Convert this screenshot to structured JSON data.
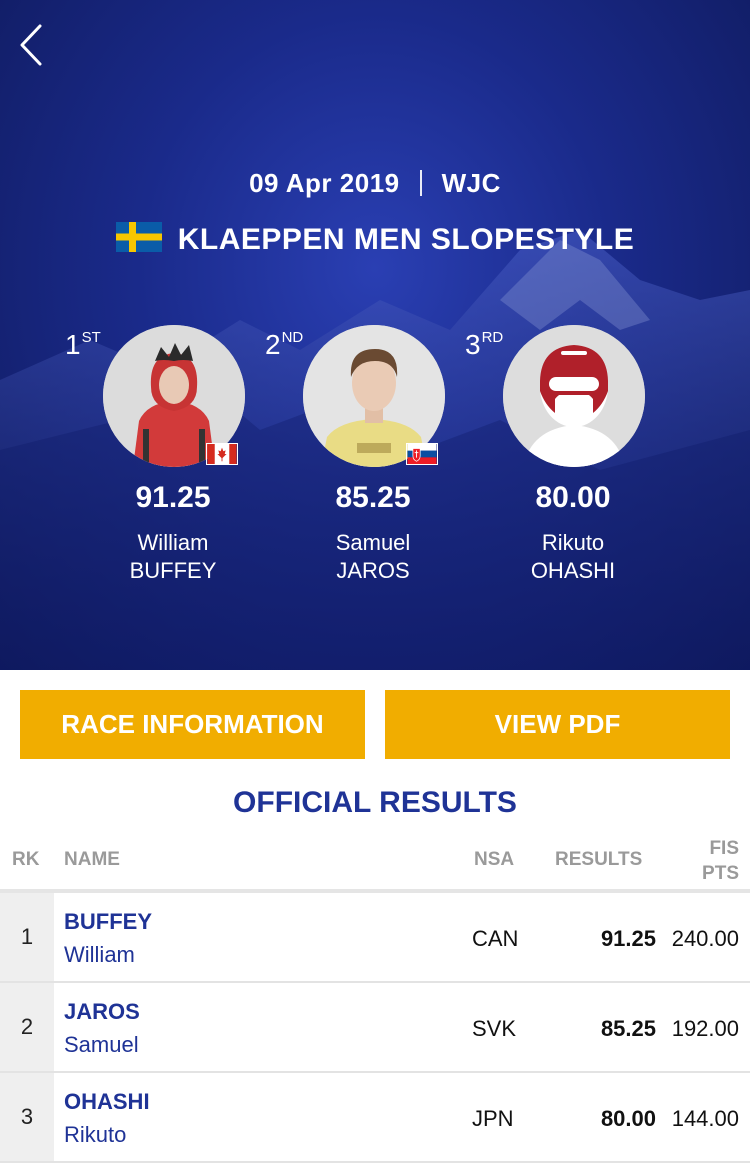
{
  "header": {
    "date": "09 Apr 2019",
    "category": "WJC",
    "event_title": "KLAEPPEN MEN SLOPESTYLE",
    "event_country_flag": "sweden-flag"
  },
  "podium": [
    {
      "rank": "1",
      "rank_suffix": "ST",
      "score": "91.25",
      "first_name": "William",
      "last_name": "BUFFEY",
      "flag": "canada-flag"
    },
    {
      "rank": "2",
      "rank_suffix": "ND",
      "score": "85.25",
      "first_name": "Samuel",
      "last_name": "JAROS",
      "flag": "slovakia-flag"
    },
    {
      "rank": "3",
      "rank_suffix": "RD",
      "score": "80.00",
      "first_name": "Rikuto",
      "last_name": "OHASHI",
      "flag": ""
    }
  ],
  "buttons": {
    "race_info": "RACE INFORMATION",
    "view_pdf": "VIEW PDF"
  },
  "results": {
    "title": "OFFICIAL RESULTS",
    "columns": {
      "rk": "RK",
      "name": "NAME",
      "nsa": "NSA",
      "results": "RESULTS",
      "fis_line1": "FIS",
      "fis_line2": "PTS"
    },
    "rows": [
      {
        "rk": "1",
        "last": "BUFFEY",
        "first": "William",
        "nsa": "CAN",
        "result": "91.25",
        "fis": "240.00"
      },
      {
        "rk": "2",
        "last": "JAROS",
        "first": "Samuel",
        "nsa": "SVK",
        "result": "85.25",
        "fis": "192.00"
      },
      {
        "rk": "3",
        "last": "OHASHI",
        "first": "Rikuto",
        "nsa": "JPN",
        "result": "80.00",
        "fis": "144.00"
      }
    ]
  },
  "colors": {
    "hero_blue": "#1a2a8a",
    "accent_yellow": "#f1ad00",
    "link_blue": "#1f3396"
  }
}
